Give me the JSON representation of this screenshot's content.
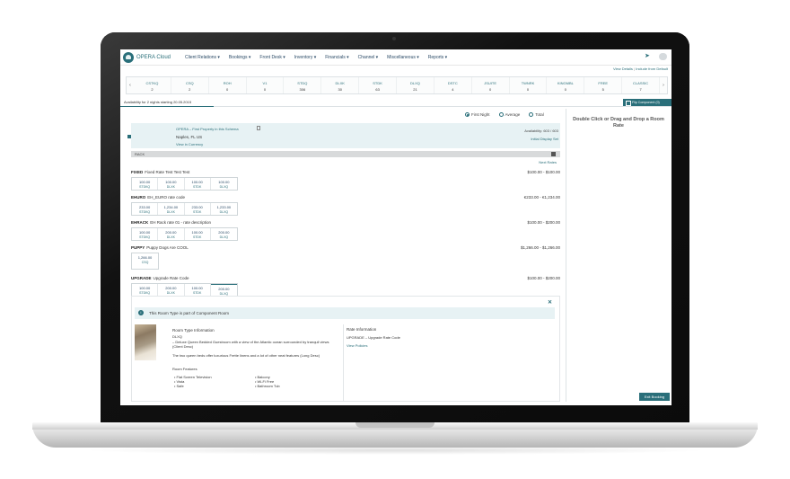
{
  "app": {
    "logo_text": "OPERA Cloud"
  },
  "nav": [
    "Client Relations ▾",
    "Bookings ▾",
    "Front Desk ▾",
    "Inventory ▾",
    "Financials ▾",
    "Channel ▾",
    "Miscellaneous ▾",
    "Reports ▾"
  ],
  "top_links": {
    "view_details": "View Details",
    "include_from_default": "Include from Default"
  },
  "strip": {
    "prev": "‹",
    "next": "›",
    "columns": [
      {
        "code": "CSTKQ",
        "count": "2"
      },
      {
        "code": "CSQ",
        "count": "2"
      },
      {
        "code": "ROH",
        "count": "0"
      },
      {
        "code": "V1",
        "count": "0"
      },
      {
        "code": "STDQ",
        "count": "306"
      },
      {
        "code": "DLXK",
        "count": "30"
      },
      {
        "code": "STDK",
        "count": "63"
      },
      {
        "code": "DLXQ",
        "count": "21"
      },
      {
        "code": "DSTC",
        "count": "4"
      },
      {
        "code": "JSUITE",
        "count": "0"
      },
      {
        "code": "TWNRK",
        "count": "0"
      },
      {
        "code": "KINGMBL",
        "count": "0"
      },
      {
        "code": "FREE",
        "count": "5"
      },
      {
        "code": "CLASSIC",
        "count": "7"
      }
    ]
  },
  "availability_tab": "Availability for 2 nights starting 20.05.2015",
  "flip_button": "Flip Component (0)",
  "right_panel": {
    "title": "Double Click or Drag and Drop a Room Rate"
  },
  "price_mode": {
    "options": [
      "First Night",
      "Average",
      "Total"
    ],
    "selected": "First Night"
  },
  "property": {
    "name": "OPERA – First Property in this Schema",
    "location": "Naples, FL US",
    "map_link": "View in Currency",
    "availability": "Availability: 603 / 603",
    "display_link": "Initial Display Set"
  },
  "rack": {
    "label": "RACK"
  },
  "next_rates": "Next Rates",
  "rates": [
    {
      "code": "FIXED",
      "name": "Fixed Rate Test Test Test",
      "price": "$100.00 - $100.00",
      "cells": [
        {
          "amount": "100.00",
          "room": "STDKQ"
        },
        {
          "amount": "100.00",
          "room": "DLXK"
        },
        {
          "amount": "100.00",
          "room": "STDK"
        },
        {
          "amount": "100.00",
          "room": "DLXQ"
        }
      ]
    },
    {
      "code": "EHURO",
      "name": "EH_EURO rate code",
      "price": "€233.00 - €1,234.00",
      "cells": [
        {
          "amount": "233.00",
          "room": "STDKQ"
        },
        {
          "amount": "1,234.00",
          "room": "DLXK"
        },
        {
          "amount": "233.00",
          "room": "STDK"
        },
        {
          "amount": "1,233.00",
          "room": "DLXQ"
        }
      ]
    },
    {
      "code": "EHRACK",
      "name": "EH Rack rate 01 - rate description",
      "price": "$100.00 - $200.00",
      "cells": [
        {
          "amount": "100.00",
          "room": "STDKQ"
        },
        {
          "amount": "200.00",
          "room": "DLXK"
        },
        {
          "amount": "100.00",
          "room": "STDK"
        },
        {
          "amount": "200.00",
          "room": "DLXQ"
        }
      ]
    },
    {
      "code": "PUPPY",
      "name": "Puppy Dogs Are COOL",
      "price": "$1,266.00 - $1,266.00",
      "cells": [
        {
          "amount": "1,266.00",
          "room": "CSQ"
        }
      ]
    },
    {
      "code": "UPGRADE",
      "name": "Upgrade Rate Code",
      "price": "$100.00 - $200.00",
      "cells": [
        {
          "amount": "100.00",
          "room": "STDKQ"
        },
        {
          "amount": "200.00",
          "room": "DLXK"
        },
        {
          "amount": "100.00",
          "room": "STDK"
        },
        {
          "amount": "200.00",
          "room": "DLXQ"
        }
      ]
    }
  ],
  "detail": {
    "banner": "This Room Type is part of Component Room",
    "room_info_title": "Room Type Information",
    "room_code": "DLXQ",
    "description_1": "– Deluxe Queen Bedded Guestroom with a view of the Atlantic ocean surrounded by tranquil views (Client Desc)",
    "description_2": "The two queen beds offer luxurious Frette linens and a lot of other neat features (Long Desc)",
    "features_title": "Room Features",
    "features_left": [
      "Flat Screen Television",
      "Vista",
      "Safe"
    ],
    "features_right": [
      "Balcony",
      "Wi-Fi Free",
      "Bathroom Tub"
    ],
    "rate_info_title": "Rate Information",
    "rate_info_code": "UPGRADE – Upgrade Rate Code",
    "rate_info_link": "View Policies"
  },
  "exit_button": "Exit Booking",
  "colors": {
    "accent": "#2a6f7a",
    "panel_bg": "#e7f2f4"
  }
}
